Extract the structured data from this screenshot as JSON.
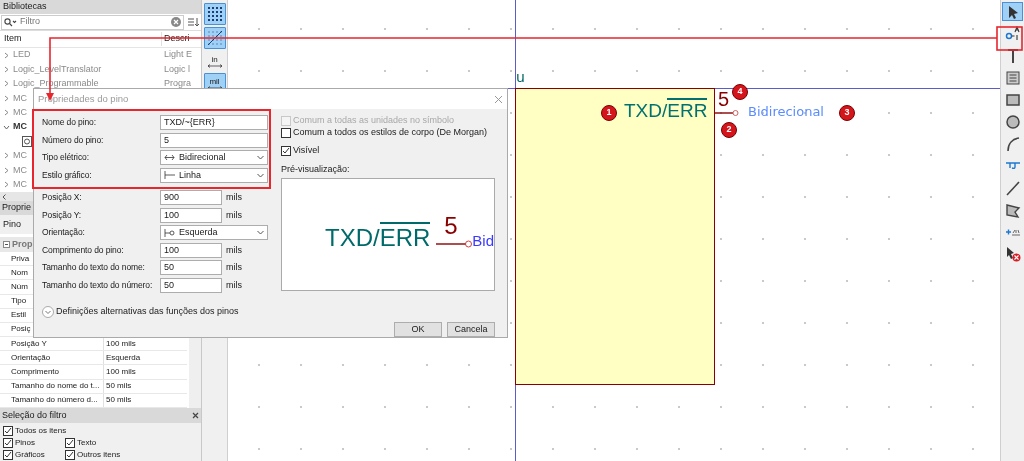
{
  "libraries": {
    "title": "Bibliotecas",
    "search": {
      "placeholder": "Filtro"
    },
    "columns": [
      "Item",
      "Descri"
    ],
    "items": [
      {
        "name": "LED",
        "description": "Light E",
        "expanded": false
      },
      {
        "name": "Logic_LevelTranslator",
        "description": "Logic l",
        "expanded": false
      },
      {
        "name": "Logic_Programmable",
        "description": "Progra",
        "expanded": false
      },
      {
        "name": "MC",
        "expanded": false
      },
      {
        "name": "MC",
        "expanded": false
      },
      {
        "name": "MC",
        "expanded": true,
        "children": [
          {
            "kind": "symbol"
          }
        ]
      },
      {
        "name": "MC",
        "expanded": false
      },
      {
        "name": "MC",
        "expanded": false
      },
      {
        "name": "MC",
        "expanded": false
      }
    ]
  },
  "properties": {
    "title": "Proprie",
    "type": "Pino",
    "group": "Prop",
    "rows": [
      {
        "name": "Priva"
      },
      {
        "name": "Nom"
      },
      {
        "name": "Núm"
      },
      {
        "name": "Tipo"
      },
      {
        "name": "Estil"
      },
      {
        "name": "Posiç"
      },
      {
        "name": "Posição Y",
        "value": "100 mils"
      },
      {
        "name": "Orientação",
        "value": "Esquerda"
      },
      {
        "name": "Comprimento",
        "value": "100 mils"
      },
      {
        "name": "Tamanho do nome do t...",
        "value": "50 mils"
      },
      {
        "name": "Tamanho do número d...",
        "value": "50 mils"
      }
    ]
  },
  "filter": {
    "title": "Seleção do filtro",
    "options": [
      {
        "label": "Todos os itens",
        "checked": true
      },
      {
        "label": "Pinos",
        "checked": true
      },
      {
        "label": "Texto",
        "checked": true
      },
      {
        "label": "Gráficos",
        "checked": true
      },
      {
        "label": "Outros itens",
        "checked": true
      }
    ]
  },
  "view_toolbar": [
    {
      "kind": "grid",
      "selected": true
    },
    {
      "kind": "grid_overlay",
      "selected": true
    },
    {
      "kind": "unit",
      "label": "in",
      "selected": false
    },
    {
      "kind": "unit",
      "label": "mil",
      "selected": true
    }
  ],
  "tools": [
    {
      "kind": "select",
      "selected": true
    },
    {
      "kind": "pin",
      "selected": false
    },
    {
      "kind": "text",
      "selected": false
    },
    {
      "kind": "textbox",
      "selected": false
    },
    {
      "kind": "rectangle",
      "selected": false
    },
    {
      "kind": "circle",
      "selected": false
    },
    {
      "kind": "arc",
      "selected": false
    },
    {
      "kind": "bezier",
      "selected": false
    },
    {
      "kind": "line",
      "selected": false
    },
    {
      "kind": "polygon",
      "selected": false
    },
    {
      "kind": "anchor",
      "selected": false
    },
    {
      "kind": "delete",
      "selected": false
    }
  ],
  "canvas": {
    "unit_label": "u",
    "pin": {
      "name": "TXD/",
      "name_overbar": "ERR",
      "number": "5",
      "type": "Bidirecional"
    },
    "callouts": [
      "1",
      "2",
      "3",
      "4"
    ]
  },
  "dialog": {
    "title": "Propriedades do pino",
    "fields": [
      {
        "kind": "text",
        "label": "Nome do pino:",
        "value": "TXD/~{ERR}"
      },
      {
        "kind": "text",
        "label": "Número do pino:",
        "value": "5"
      },
      {
        "kind": "select",
        "label": "Tipo elétrico:",
        "value": "Bidirecional"
      },
      {
        "kind": "select",
        "label": "Estilo gráfico:",
        "value": "Linha"
      },
      {
        "kind": "number",
        "label": "Posição X:",
        "value": "900",
        "unit": "mils"
      },
      {
        "kind": "number",
        "label": "Posição Y:",
        "value": "100",
        "unit": "mils"
      },
      {
        "kind": "select",
        "label": "Orientação:",
        "value": "Esquerda"
      },
      {
        "kind": "number",
        "label": "Comprimento do pino:",
        "value": "100",
        "unit": "mils"
      },
      {
        "kind": "number",
        "label": "Tamanho do texto do nome:",
        "value": "50",
        "unit": "mils"
      },
      {
        "kind": "number",
        "label": "Tamanho do texto do número:",
        "value": "50",
        "unit": "mils"
      }
    ],
    "options": [
      {
        "label": "Comum a todas as unidades no símbolo",
        "checked": false,
        "disabled": true
      },
      {
        "label": "Comum a todos os estilos de corpo (De Morgan)",
        "checked": false,
        "disabled": false
      },
      {
        "label": "Visível",
        "checked": true,
        "disabled": false
      }
    ],
    "preview": {
      "label": "Pré-visualização:",
      "name": "TXD/",
      "name_overbar": "ERR",
      "number": "5",
      "type": "Bid"
    },
    "expander": {
      "label": "Definições alternativas das funções dos pinos",
      "expanded": false
    },
    "buttons": [
      "OK",
      "Cancela"
    ]
  }
}
